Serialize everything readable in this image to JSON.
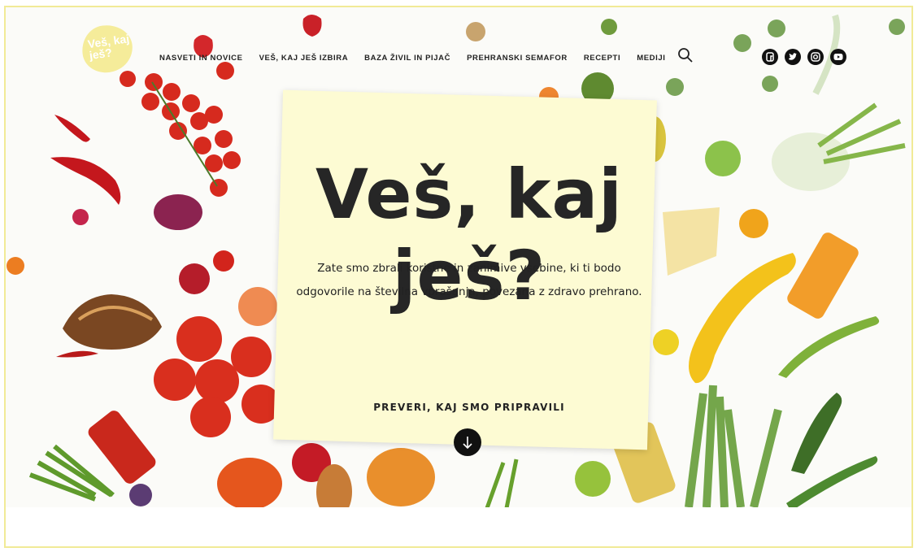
{
  "logo": {
    "text": "Veš, kaj ješ?"
  },
  "nav": {
    "items": [
      "NASVETI IN NOVICE",
      "VEŠ, KAJ JEŠ IZBIRA",
      "BAZA ŽIVIL IN PIJAČ",
      "PREHRANSKI SEMAFOR",
      "RECEPTI",
      "MEDIJI"
    ],
    "search_icon": "search-icon",
    "social": [
      "facebook-icon",
      "twitter-icon",
      "instagram-icon",
      "youtube-icon"
    ]
  },
  "hero": {
    "title": "Veš, kaj ješ?",
    "subtitle": "Zate smo zbrali koristne in zanimive vsebine, ki ti bodo odgovorile na številna vprašanja, povezana z zdravo prehrano.",
    "cta": "PREVERI, KAJ SMO PRIPRAVILI",
    "scroll_icon": "arrow-down-icon"
  },
  "colors": {
    "accent_yellow": "#f5ec9a",
    "card": "#fdfbd3",
    "text": "#262626",
    "frame": "#f1ea97"
  }
}
